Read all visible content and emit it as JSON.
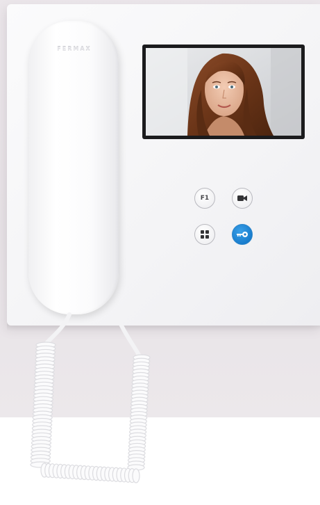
{
  "device": {
    "brand_label": "FERMAX",
    "buttons": [
      {
        "id": "f1",
        "label": "F1",
        "icon": "text"
      },
      {
        "id": "camera",
        "label": "",
        "icon": "camera-icon"
      },
      {
        "id": "menu",
        "label": "",
        "icon": "grid-icon"
      },
      {
        "id": "door",
        "label": "",
        "icon": "key-icon"
      }
    ]
  },
  "colors": {
    "body": "#f6f6f8",
    "backdrop": "#e9e4e8",
    "screen_bezel": "#1b1b1d",
    "door_button": "#1478c9"
  }
}
